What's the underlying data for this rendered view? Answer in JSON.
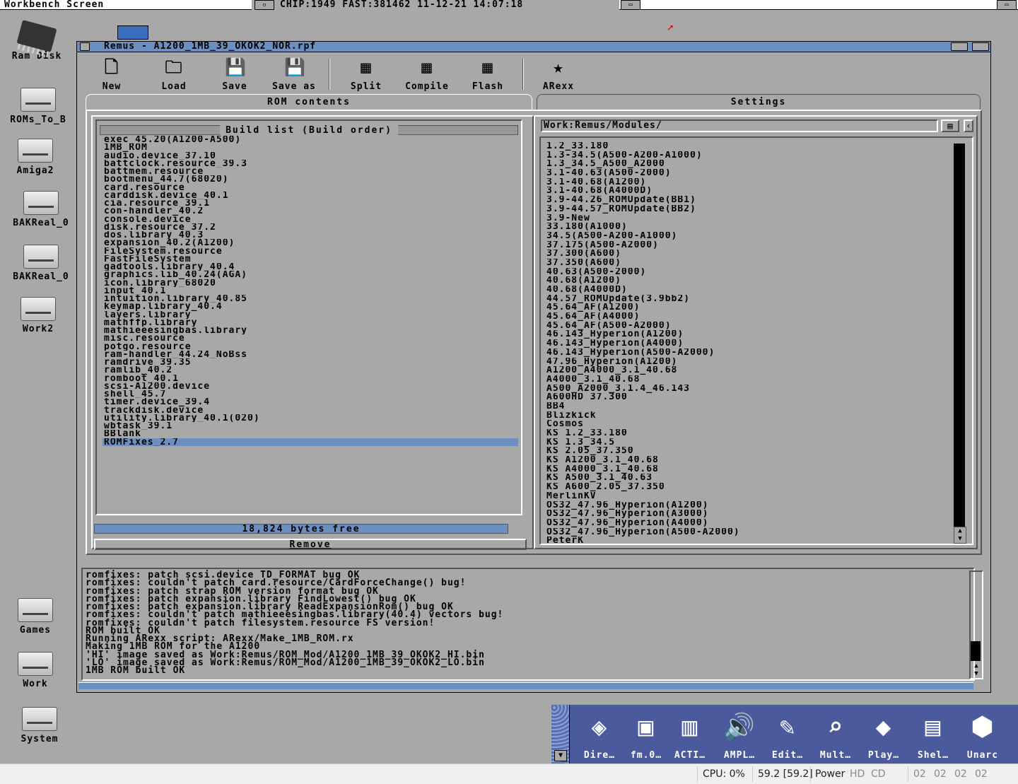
{
  "screen": {
    "title": "Workbench Screen",
    "stats": "CHIP:1949 FAST:381462 11-12-21 14:07:18"
  },
  "desktop_icons": [
    {
      "label": "Ram Disk",
      "icon": "ram-chip-icon"
    },
    {
      "label": "ROMs_To_B",
      "icon": "drive-icon"
    },
    {
      "label": "Amiga2",
      "icon": "drive-icon"
    },
    {
      "label": "BAKReal_0",
      "icon": "drive-icon"
    },
    {
      "label": "BAKReal_0",
      "icon": "drive-icon"
    },
    {
      "label": "Work2",
      "icon": "drive-icon"
    },
    {
      "label": "Games",
      "icon": "drive-icon"
    },
    {
      "label": "Work",
      "icon": "drive-icon"
    },
    {
      "label": "System",
      "icon": "boing-drive-icon"
    }
  ],
  "window": {
    "title": "Remus - A1200_1MB_39_OKOK2_NOR.rpf",
    "toolbar": [
      {
        "label": "New",
        "icon": "new-doc-icon"
      },
      {
        "label": "Load",
        "icon": "folder-icon"
      },
      {
        "label": "Save",
        "icon": "disk-icon"
      },
      {
        "label": "Save as",
        "icon": "disk-icon"
      },
      {
        "label": "Split",
        "icon": "chip-icon"
      },
      {
        "label": "Compile",
        "icon": "chip-icon"
      },
      {
        "label": "Flash",
        "icon": "chip-icon"
      },
      {
        "label": "ARexx",
        "icon": "arexx-icon"
      }
    ],
    "tabs": [
      {
        "label": "ROM contents",
        "active": true
      },
      {
        "label": "Settings",
        "active": false
      }
    ],
    "build_list": {
      "header": "Build list (Build order)",
      "items": [
        "exec_45.20(A1200-A500)",
        "1MB_ROM",
        "audio.device_37.10",
        "battclock.resource_39.3",
        "battmem.resource",
        "bootmenu_44.7(68020)",
        "card.resource",
        "carddisk.device_40.1",
        "cia.resource_39.1",
        "con-handler_40.2",
        "console.device",
        "disk.resource_37.2",
        "dos.library_40.3",
        "expansion_40.2(A1200)",
        "FileSystem.resource",
        "FastFileSystem",
        "gadtools.library_40.4",
        "graphics.lib_40.24(AGA)",
        "icon.library_68020",
        "input_40.1",
        "intuition.library_40.85",
        "keymap.library_40.4",
        "layers.library",
        "mathffp.library",
        "mathieeesingbas.library",
        "misc.resource",
        "potgo.resource",
        "ram-handler_44.24_NoBss",
        "ramdrive_39.35",
        "ramlib_40.2",
        "romboot_40.1",
        "scsi-A1200.device",
        "shell_45.7",
        "timer.device_39.4",
        "trackdisk.device",
        "utility.library_40.1(020)",
        "wbtask_39.1",
        "BBlank",
        "ROMFixes_2.7"
      ],
      "selected_index": 38
    },
    "bytes_free": "18,824 bytes free",
    "remove_label": "Remove",
    "module_path": "Work:Remus/Modules/",
    "modules": [
      "1.2_33.180",
      "1.3-34.5(A500-A200-A1000)",
      "1.3_34.5_A500_A2000",
      "3.1-40.63(A500-2000)",
      "3.1-40.68(A1200)",
      "3.1-40.68(A4000D)",
      "3.9-44.26_ROMUpdate(BB1)",
      "3.9-44.57_ROMUpdate(BB2)",
      "3.9-New",
      "33.180(A1000)",
      "34.5(A500-A200-A1000)",
      "37.175(A500-A2000)",
      "37.300(A600)",
      "37.350(A600)",
      "40.63(A500-2000)",
      "40.68(A1200)",
      "40.68(A4000D)",
      "44.57_ROMUpdate(3.9bb2)",
      "45.64_AF(A1200)",
      "45.64_AF(A4000)",
      "45.64_AF(A500-A2000)",
      "46.143_Hyperion(A1200)",
      "46.143_Hyperion(A4000)",
      "46.143_Hyperion(A500-A2000)",
      "47.96_Hyperion(A1200)",
      "A1200_A4000_3.1_40.68",
      "A4000_3.1_40.68",
      "A500_A2000_3.1.4_46.143",
      "A600HD 37.300",
      "BB4",
      "Blizkick",
      "Cosmos",
      "KS 1.2_33.180",
      "KS 1.3_34.5",
      "KS 2.05_37.350",
      "KS A1200_3.1_40.68",
      "KS A4000_3.1_40.68",
      "KS A500_3.1_40.63",
      "KS A600_2.05_37.350",
      "MerlinKV",
      "OS32_47.96_Hyperion(A1200)",
      "OS32_47.96_Hyperion(A3000)",
      "OS32_47.96_Hyperion(A4000)",
      "OS32_47.96_Hyperion(A500-A2000)",
      "PeterK"
    ],
    "log": [
      "romfixes: patch scsi.device TD_FORMAT bug OK",
      "romfixes: couldn't patch card.resource/CardForceChange() bug!",
      "romfixes: patch strap ROM version format bug OK",
      "romfixes: patch expansion.library FindLowest() bug OK",
      "romfixes: patch expansion.library ReadExpansionRom() bug OK",
      "romfixes: couldn't patch mathieeesingbas.library(40.4) vectors bug!",
      "romfixes: couldn't patch filesystem.resource FS version!",
      "ROM built OK",
      "Running ARexx script: ARexx/Make_1MB_ROM.rx",
      "Making 1MB ROM for the A1200",
      "'HI' image saved as Work:Remus/ROM_Mod/A1200_1MB_39_OKOK2_HI.bin",
      "'LO' image saved as Work:Remus/ROM_Mod/A1200_1MB_39_OKOK2_LO.bin",
      "1MB ROM built OK"
    ]
  },
  "dock": [
    {
      "label": "Dire…",
      "icon": "directory-opus-icon"
    },
    {
      "label": "fm.0…",
      "icon": "file-manager-icon"
    },
    {
      "label": "ACTI…",
      "icon": "action-icon"
    },
    {
      "label": "AMPL…",
      "icon": "speaker-icon"
    },
    {
      "label": "Edit…",
      "icon": "notepad-icon"
    },
    {
      "label": "Mult…",
      "icon": "magnifier-icon"
    },
    {
      "label": "Play…",
      "icon": "player-icon"
    },
    {
      "label": "Shel…",
      "icon": "shell-icon"
    },
    {
      "label": "Unarc",
      "icon": "unarc-icon"
    }
  ],
  "statusbar": {
    "cpu": "CPU: 0%",
    "fps": "59.2 [59.2]",
    "power": "Power",
    "hd": "HD",
    "cd": "CD",
    "drives": [
      "02",
      "02",
      "02",
      "02"
    ]
  },
  "colors": {
    "background": "#a8a8a8",
    "accent": "#6b8fc0"
  }
}
